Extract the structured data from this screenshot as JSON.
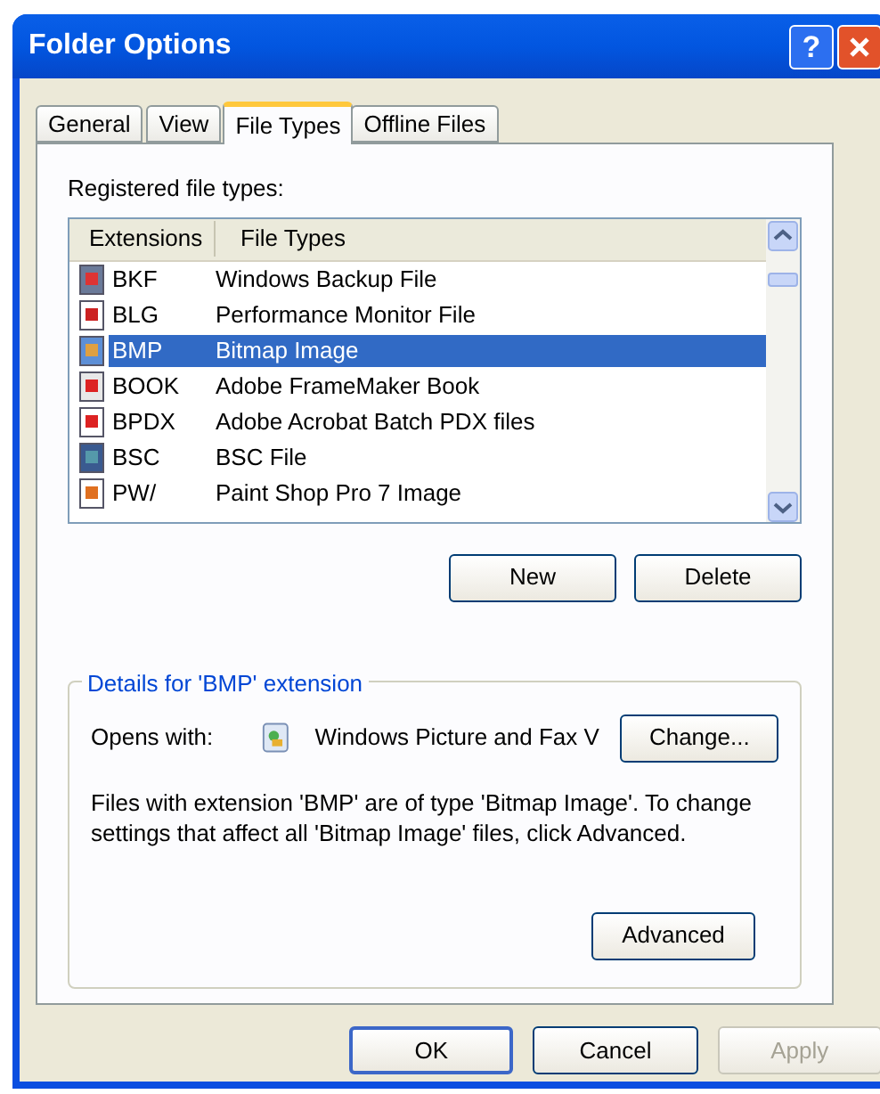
{
  "window": {
    "title": "Folder Options",
    "help_button": "?"
  },
  "tabs": [
    {
      "label": "General",
      "selected": false
    },
    {
      "label": "View",
      "selected": false
    },
    {
      "label": "File Types",
      "selected": true
    },
    {
      "label": "Offline Files",
      "selected": false
    }
  ],
  "registered_label": "Registered file types:",
  "list": {
    "columns": [
      "Extensions",
      "File Types"
    ],
    "rows": [
      {
        "kind": "backup",
        "extension": "BKF",
        "file_type": "Windows Backup File",
        "selected": false
      },
      {
        "kind": "monitor",
        "extension": "BLG",
        "file_type": "Performance Monitor File",
        "selected": false
      },
      {
        "kind": "bitmap",
        "extension": "BMP",
        "file_type": "Bitmap Image",
        "selected": true
      },
      {
        "kind": "book",
        "extension": "BOOK",
        "file_type": "Adobe FrameMaker Book",
        "selected": false
      },
      {
        "kind": "pdf",
        "extension": "BPDX",
        "file_type": "Adobe Acrobat Batch PDX files",
        "selected": false
      },
      {
        "kind": "app",
        "extension": "BSC",
        "file_type": "BSC File",
        "selected": false
      },
      {
        "kind": "paint",
        "extension": "PW/",
        "file_type": "Paint Shop Pro 7 Image",
        "selected": false
      }
    ]
  },
  "list_buttons": [
    {
      "label": "New",
      "disabled": false
    },
    {
      "label": "Delete",
      "disabled": false
    }
  ],
  "details": {
    "legend": "Details for 'BMP' extension",
    "opens_with_label": "Opens with:",
    "opens_with_app": "Windows Picture and Fax V",
    "change_button": "Change...",
    "description": "Files with extension 'BMP' are of type 'Bitmap Image'.  To change settings that affect all 'Bitmap Image' files, click Advanced.",
    "advanced_button": "Advanced"
  },
  "dialog_buttons": [
    {
      "label": "OK",
      "disabled": false,
      "default": true
    },
    {
      "label": "Cancel",
      "disabled": false,
      "default": false
    },
    {
      "label": "Apply",
      "disabled": true,
      "default": false
    }
  ]
}
